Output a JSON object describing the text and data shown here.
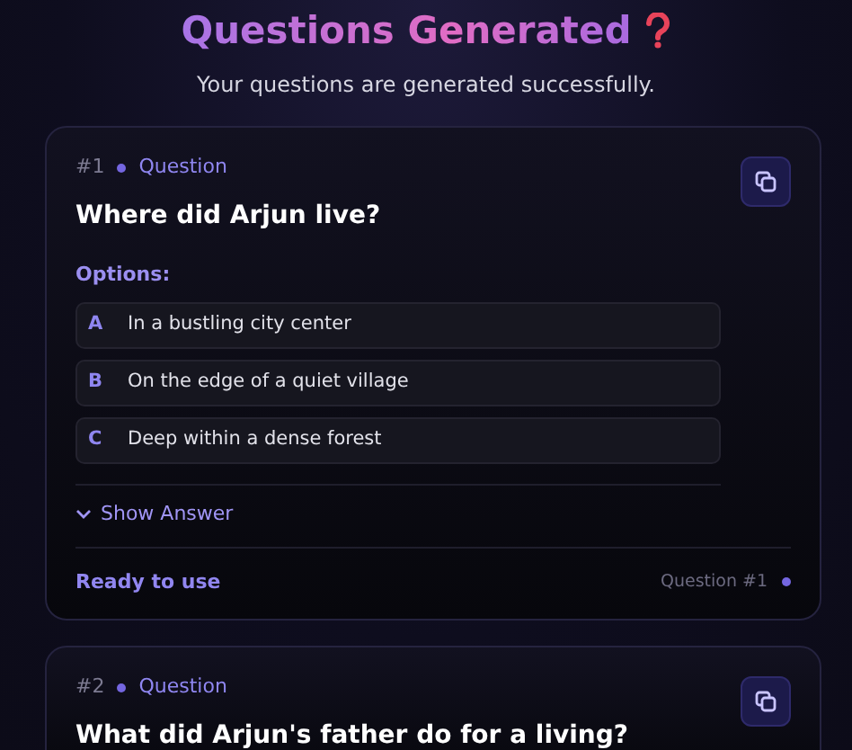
{
  "header": {
    "title": "Questions Generated",
    "subtitle": "Your questions are generated successfully."
  },
  "cards": [
    {
      "number": "#1",
      "tag": "Question",
      "question": "Where did Arjun live?",
      "options_label": "Options:",
      "options": [
        {
          "letter": "A",
          "text": "In a bustling city center"
        },
        {
          "letter": "B",
          "text": "On the edge of a quiet village"
        },
        {
          "letter": "C",
          "text": "Deep within a dense forest"
        }
      ],
      "toggle": "Show Answer",
      "status": "Ready to use",
      "footer_label": "Question #1"
    },
    {
      "number": "#2",
      "tag": "Question",
      "question": "What did Arjun's father do for a living?"
    }
  ]
}
